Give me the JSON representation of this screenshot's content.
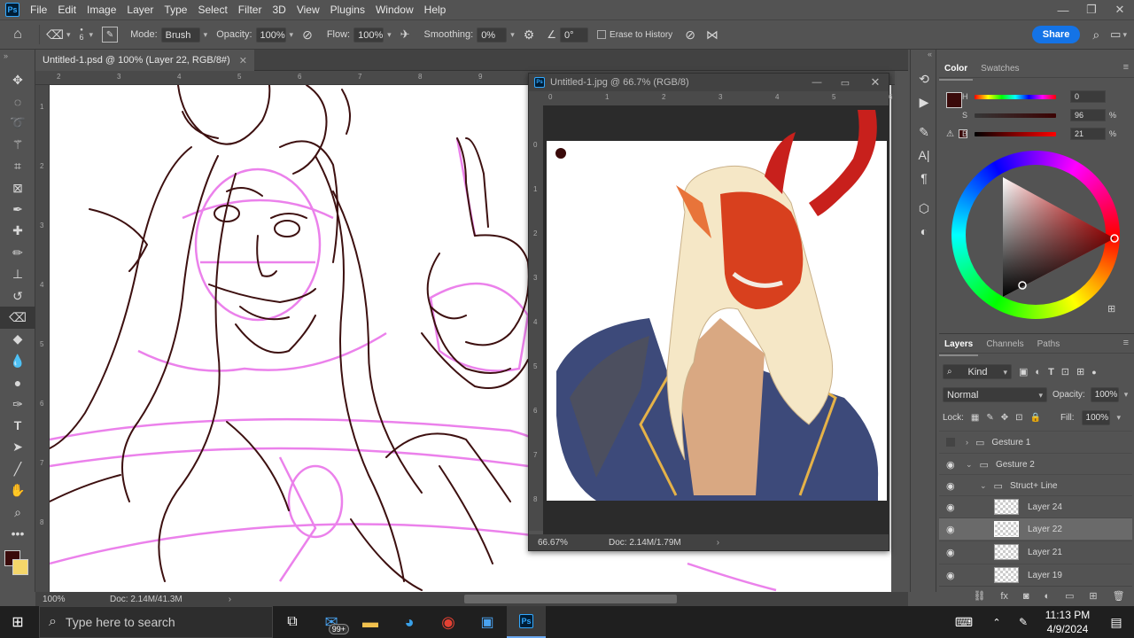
{
  "app": {
    "name": "Ps"
  },
  "menu": [
    "File",
    "Edit",
    "Image",
    "Layer",
    "Type",
    "Select",
    "Filter",
    "3D",
    "View",
    "Plugins",
    "Window",
    "Help"
  ],
  "options": {
    "brush_size": "6",
    "mode_label": "Mode:",
    "mode_value": "Brush",
    "opacity_label": "Opacity:",
    "opacity_value": "100%",
    "flow_label": "Flow:",
    "flow_value": "100%",
    "smoothing_label": "Smoothing:",
    "smoothing_value": "0%",
    "angle_value": "0°",
    "erase_history_label": "Erase to History",
    "share_label": "Share"
  },
  "document": {
    "tab_title": "Untitled-1.psd @ 100% (Layer 22, RGB/8#)",
    "zoom": "100%",
    "doc_size": "Doc: 2.14M/41.3M",
    "ruler_top": [
      "2",
      "3",
      "4",
      "5",
      "6",
      "7",
      "8",
      "9"
    ],
    "ruler_left": [
      "1",
      "2",
      "3",
      "4",
      "5",
      "6",
      "7",
      "8"
    ]
  },
  "reference_window": {
    "title": "Untitled-1.jpg @ 66.7% (RGB/8)",
    "zoom": "66.67%",
    "doc_size": "Doc: 2.14M/1.79M",
    "ruler_top": [
      "0",
      "1",
      "2",
      "3",
      "4",
      "5",
      "6"
    ],
    "ruler_left": [
      "0",
      "1",
      "2",
      "3",
      "4",
      "5",
      "6",
      "7",
      "8",
      "9"
    ]
  },
  "color_panel": {
    "tabs": [
      "Color",
      "Swatches"
    ],
    "h_label": "H",
    "h_value": "0",
    "s_label": "S",
    "s_value": "96",
    "b_label": "B",
    "b_value": "21",
    "pct": "%",
    "foreground": "#3a0a0a",
    "background": "#f4d66a"
  },
  "layers_panel": {
    "tabs": [
      "Layers",
      "Channels",
      "Paths"
    ],
    "kind_label": "Kind",
    "blend_mode": "Normal",
    "opacity_label": "Opacity:",
    "opacity_value": "100%",
    "lock_label": "Lock:",
    "fill_label": "Fill:",
    "fill_value": "100%",
    "layers": [
      {
        "name": "Gesture 1",
        "type": "group"
      },
      {
        "name": "Gesture 2",
        "type": "group"
      },
      {
        "name": "Struct+ Line",
        "type": "group"
      },
      {
        "name": "Layer 24",
        "type": "layer"
      },
      {
        "name": "Layer 22",
        "type": "layer",
        "selected": true
      },
      {
        "name": "Layer 21",
        "type": "layer"
      },
      {
        "name": "Layer 19",
        "type": "layer"
      }
    ]
  },
  "taskbar": {
    "search_placeholder": "Type here to search",
    "mail_badge": "99+",
    "time": "11:13 PM",
    "date": "4/9/2024"
  }
}
